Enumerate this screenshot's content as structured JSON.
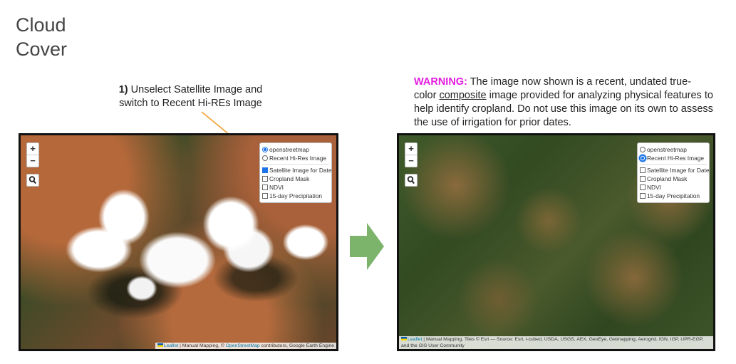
{
  "title": {
    "line1": "Cloud",
    "line2": "Cover"
  },
  "instruction": {
    "number": "1)",
    "text": " Unselect Satellite Image and switch to Recent Hi-REs Image"
  },
  "warning": {
    "label": "WARNING",
    "colon": ":",
    "pre": "  The image now shown is a recent, undated true-color ",
    "underlined": "composite",
    "post": " image provided for analyzing physical features  to help identify cropland.  Do not use this image on its own to assess the use of irrigation for prior dates."
  },
  "map_controls": {
    "zoom_in": "+",
    "zoom_out": "−"
  },
  "left_map": {
    "layers": {
      "base": [
        {
          "label": "openstreetmap",
          "selected": true
        },
        {
          "label": "Recent Hi-Res Image",
          "selected": false
        }
      ],
      "overlays": [
        {
          "label": "Satellite Image for Date",
          "checked": true
        },
        {
          "label": "Cropland Mask",
          "checked": false
        },
        {
          "label": "NDVI",
          "checked": false
        },
        {
          "label": "15-day Precipitation",
          "checked": false
        }
      ]
    },
    "attribution": {
      "leaflet": "Leaflet",
      "mid": " | Manual Mapping, © ",
      "osm": "OpenStreetMap",
      "end": " contributors, Google Earth Engine"
    }
  },
  "right_map": {
    "layers": {
      "base": [
        {
          "label": "openstreetmap",
          "selected": false
        },
        {
          "label": "Recent Hi-Res Image",
          "selected": true
        }
      ],
      "overlays": [
        {
          "label": "Satellite Image for Date",
          "checked": false
        },
        {
          "label": "Cropland Mask",
          "checked": false
        },
        {
          "label": "NDVI",
          "checked": false
        },
        {
          "label": "15-day Precipitation",
          "checked": false
        }
      ]
    },
    "attribution": {
      "leaflet": "Leaflet",
      "text": " | Manual Mapping, Tiles © Esri — Source: Esri, i-cubed, USDA, USGS, AEX, GeoEye, Getmapping, Aerogrid, IGN, IGP, UPR-EGP, and the GIS User Community"
    }
  },
  "colors": {
    "warning": "#e21be0",
    "annotation_arrow": "#f0a030",
    "next_arrow": "#7db46c",
    "accent": "#1a73e8"
  }
}
